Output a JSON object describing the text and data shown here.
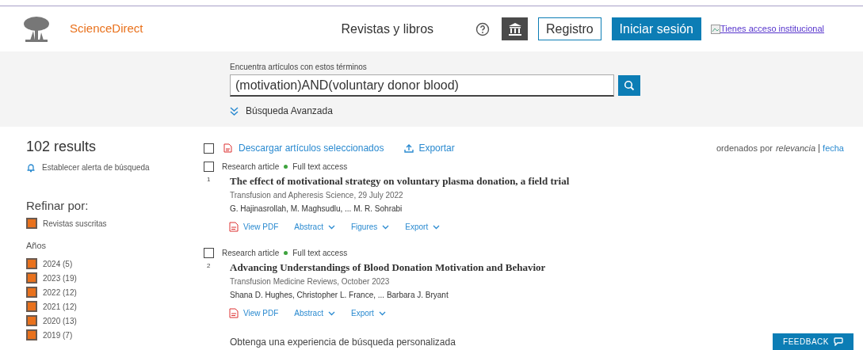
{
  "header": {
    "brand": "ScienceDirect",
    "nav_link": "Revistas y libros",
    "register_button": "Registro",
    "signin_button": "Iniciar sesión",
    "institutional_link": "Tienes acceso institucional"
  },
  "search": {
    "label": "Encuentra artículos con estos términos",
    "value": "(motivation)AND(voluntary donor blood)",
    "advanced_link": "Búsqueda Avanzada"
  },
  "sidebar": {
    "results_count": "102 results",
    "alert_link": "Establecer alerta de búsqueda",
    "refine_heading": "Refinar por:",
    "subscribed": {
      "label": "Revistas suscritas",
      "checked": true
    },
    "years_heading": "Años",
    "years": [
      {
        "label": "2024 (5)",
        "checked": true
      },
      {
        "label": "2023 (19)",
        "checked": true
      },
      {
        "label": "2022 (12)",
        "checked": true
      },
      {
        "label": "2021 (12)",
        "checked": true
      },
      {
        "label": "2020 (13)",
        "checked": true
      },
      {
        "label": "2019 (7)",
        "checked": true
      }
    ]
  },
  "toolbar": {
    "select_all_checked": false,
    "download_link": "Descargar artículos seleccionados",
    "export_link": "Exportar",
    "sort_label": "ordenados por",
    "sort_options": [
      {
        "label": "relevancia",
        "selected": true
      },
      {
        "label": "fecha",
        "selected": false
      }
    ]
  },
  "results": [
    {
      "number": "1",
      "checked": false,
      "type": "Research article",
      "access": "Full text access",
      "title": "The effect of motivational strategy on voluntary plasma donation, a field trial",
      "source": "Transfusion and Apheresis Science, 29 July 2022",
      "authors": "G. Hajinasrollah, M. Maghsudlu, ... M. R. Sohrabi",
      "actions": [
        "View PDF",
        "Abstract",
        "Figures",
        "Export"
      ]
    },
    {
      "number": "2",
      "checked": false,
      "type": "Research article",
      "access": "Full text access",
      "title": "Advancing Understandings of Blood Donation Motivation and Behavior",
      "source": "Transfusion Medicine Reviews, October 2023",
      "authors": "Shana D. Hughes, Christopher L. France, ... Barbara J. Bryant",
      "actions": [
        "View PDF",
        "Abstract",
        "Export"
      ]
    }
  ],
  "personalize_text": "Obtenga una experiencia de búsqueda personalizada",
  "feedback_button": "FEEDBACK"
}
